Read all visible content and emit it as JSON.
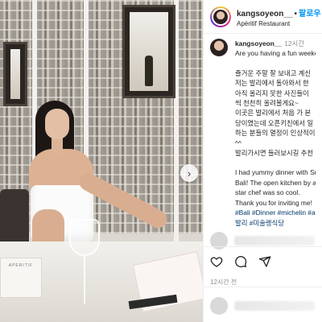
{
  "post": {
    "username": "kangsoyeon__",
    "follow_label": "팔로우",
    "separator": "•",
    "location": "Apéritif Restaurant",
    "posted_time": "12시간",
    "time_ago": "12시간 전",
    "caption_lines": [
      "Are you having a fun weeke",
      "",
      "즐거운 주말 잘 보내고 계신",
      "저는 발리에서 돌아와서 한",
      "아직 올리지 못한 사진들이",
      "씩 천천히 올려볼게요~",
      "이곳은 발리에서 처음 가 본",
      "당이였는데 오픈키친에서 일",
      "하는 분들의 열정이 인상적이",
      "^^",
      "발리가시면 들러보시길 추천",
      "",
      "I had yummy dinner with Su",
      "Bali! The open kitchen by a",
      "star chef was so cool.",
      "Thank you for inviting me!"
    ],
    "hashtags_line1": "#Bali #Dinner #michelin #ap",
    "hashtags_line2": "발리 #미술랭식당",
    "menu_card_text": "APERITIF"
  },
  "icons": {
    "heart": "heart-icon",
    "comment": "comment-icon",
    "share": "share-icon",
    "carousel_next": "chevron-right-icon"
  },
  "colors": {
    "follow": "#0095f6",
    "hashtag": "#00376b",
    "muted": "#8e8e8e"
  }
}
